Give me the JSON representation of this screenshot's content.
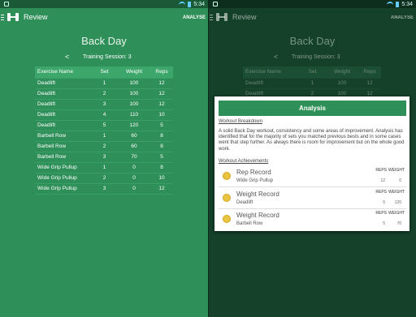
{
  "status": {
    "time": "5:34"
  },
  "appbar": {
    "title": "Review",
    "action": "ANALYSE"
  },
  "page": {
    "title": "Back Day",
    "prev_symbol": "<",
    "session_label": "Training Session: 3"
  },
  "table": {
    "headers": [
      "Exercise Name",
      "Set",
      "Weight",
      "Reps"
    ],
    "rows": [
      [
        "Deadlift",
        "1",
        "100",
        "12"
      ],
      [
        "Deadlift",
        "2",
        "100",
        "12"
      ],
      [
        "Deadlift",
        "3",
        "100",
        "12"
      ],
      [
        "Deadlift",
        "4",
        "110",
        "10"
      ],
      [
        "Deadlift",
        "5",
        "120",
        "5"
      ],
      [
        "Barbell Row",
        "1",
        "60",
        "8"
      ],
      [
        "Barbell Row",
        "2",
        "60",
        "8"
      ],
      [
        "Barbell Row",
        "3",
        "70",
        "5"
      ],
      [
        "Wide Grip Pullup",
        "1",
        "0",
        "8"
      ],
      [
        "Wide Grip Pullup",
        "2",
        "0",
        "10"
      ],
      [
        "Wide Grip Pullup",
        "3",
        "0",
        "12"
      ]
    ]
  },
  "dialog": {
    "title": "Analysis",
    "breakdown_heading": "Workout Breakdown",
    "breakdown_text": "A solid Back Day workout, consistency and some areas of improvement. Analysis has identified that for the majority of sets you matched previous bests and in some cases went that step further. As always there is room for improvement but on the whole good work.",
    "achievements_heading": "Workout Achievements",
    "reps_label": "REPS",
    "weight_label": "WEIGHT",
    "achievements": [
      {
        "title": "Rep Record",
        "exercise": "Wide Grip Pullup",
        "reps": "12",
        "weight": "0"
      },
      {
        "title": "Weight Record",
        "exercise": "Deadlift",
        "reps": "5",
        "weight": "120"
      },
      {
        "title": "Weight Record",
        "exercise": "Barbell Row",
        "reps": "5",
        "weight": "70"
      }
    ]
  },
  "colors": {
    "primary": "#2e8f58",
    "medal": "#e8c440"
  }
}
